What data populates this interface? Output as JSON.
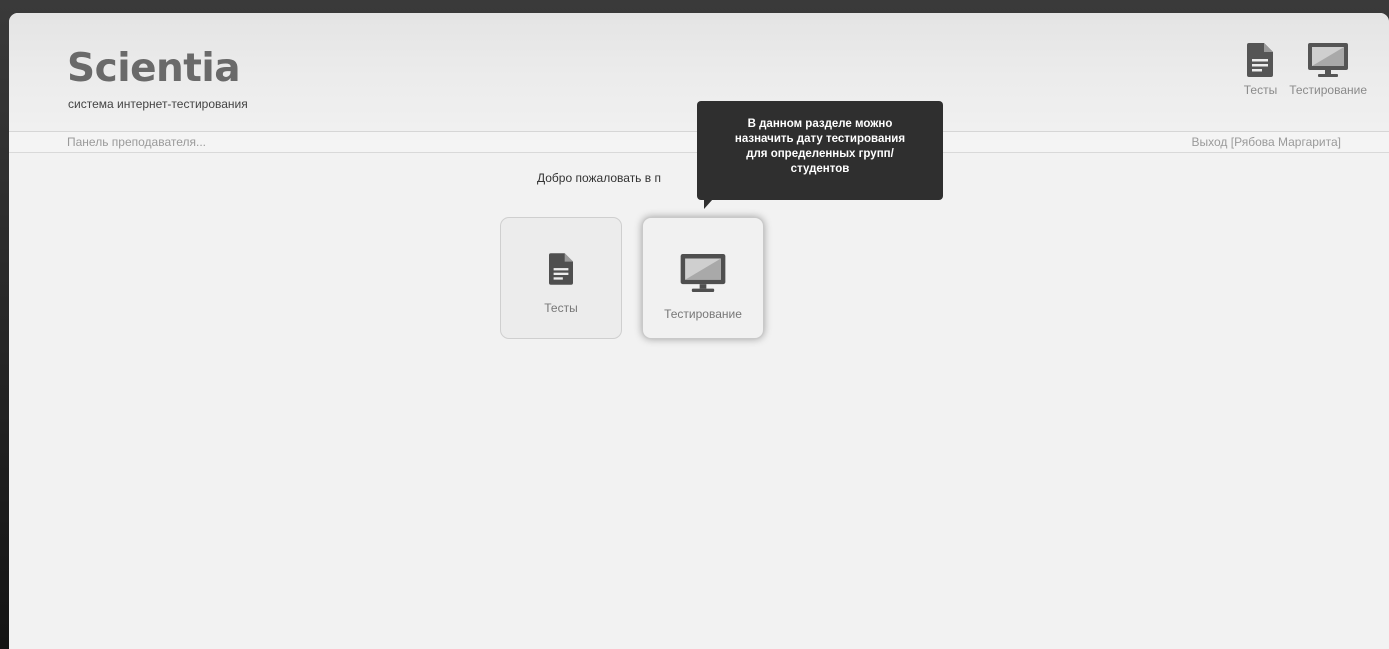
{
  "brand": {
    "logo": "Scientia",
    "tagline": "система интернет-тестирования"
  },
  "header_nav": {
    "items": [
      {
        "label": "Тесты",
        "icon": "document-icon"
      },
      {
        "label": "Тестирование",
        "icon": "monitor-icon"
      }
    ]
  },
  "subbar": {
    "panel_label": "Панель преподавателя...",
    "logout": "Выход [Рябова Маргарита]"
  },
  "main": {
    "welcome": "Добро пожаловать в п",
    "tiles": [
      {
        "label": "Тесты",
        "icon": "document-icon"
      },
      {
        "label": "Тестирование",
        "icon": "monitor-icon"
      }
    ]
  },
  "tooltip": {
    "lines": [
      "В данном разделе можно",
      "назначить дату тестирования",
      "для определенных групп/",
      "студентов"
    ]
  },
  "colors": {
    "tooltip_bg": "#2f2f2f",
    "logo": "#6a6a6a",
    "icon": "#555555"
  }
}
